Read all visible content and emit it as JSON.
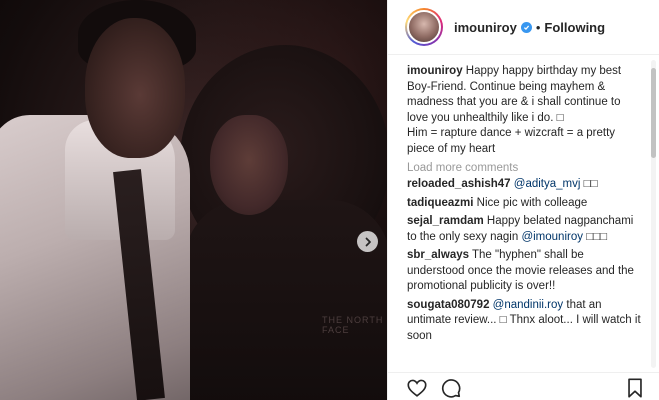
{
  "header": {
    "username": "imouniroy",
    "separator": "•",
    "follow_status": "Following"
  },
  "caption": {
    "username": "imouniroy",
    "text": "Happy happy birthday my best Boy-Friend. Continue being mayhem & madness that you are & i shall continue to love you unhealthily like i do. □",
    "line2": "Him = rapture dance + wizcraft = a pretty piece of my heart"
  },
  "load_more": "Load more comments",
  "comments": [
    {
      "username": "reloaded_ashish47",
      "mention": "@aditya_mvj",
      "text": "□□"
    },
    {
      "username": "tadiqueazmi",
      "text": "Nice pic with colleage"
    },
    {
      "username": "sejal_ramdam",
      "text": "Happy belated nagpanchami to the only sexy nagin",
      "mention": "@imouniroy",
      "text_after": "□□□"
    },
    {
      "username": "sbr_always",
      "text": "The \"hyphen\" shall be understood once the movie releases and the promotional publicity is over!!"
    },
    {
      "username": "sougata080792",
      "mention": "@nandinii.roy",
      "text": "that an untimate review... □ Thnx aloot... I will watch it soon"
    }
  ],
  "photo": {
    "jacket_text": "THE NORTH FACE"
  },
  "icons": [
    "heart-icon",
    "comment-icon",
    "bookmark-icon",
    "next-arrow-icon",
    "verified-badge-icon"
  ],
  "colors": {
    "link": "#003569",
    "verified": "#3897f0",
    "muted": "#999999"
  }
}
